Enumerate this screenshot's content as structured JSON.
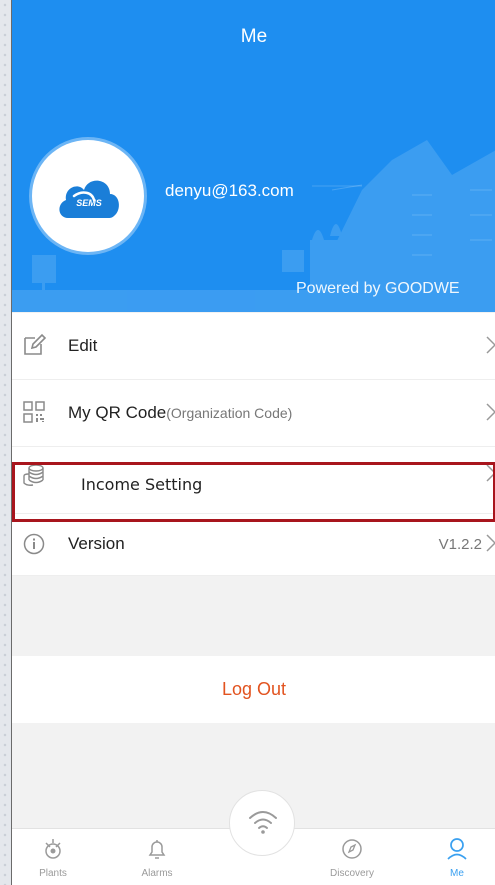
{
  "header": {
    "title": "Me",
    "email": "denyu@163.com",
    "powered_by": "Powered by GOODWE",
    "avatar_logo_text": "SEMS",
    "bg_color": "#1e8ef0"
  },
  "menu": {
    "items": [
      {
        "label": "Edit",
        "icon": "edit-icon"
      },
      {
        "label": "My QR Code",
        "sublabel": "(Organization Code)",
        "icon": "qr-code-icon"
      },
      {
        "label": "Income Setting",
        "icon": "coins-icon"
      },
      {
        "label": "Version",
        "value": "V1.2.2",
        "icon": "info-icon"
      }
    ]
  },
  "logout": {
    "label": "Log Out",
    "color": "#e2531f"
  },
  "tabbar": {
    "tabs": [
      {
        "label": "Plants",
        "icon": "plant-icon"
      },
      {
        "label": "Alarms",
        "icon": "bell-icon"
      },
      {
        "label": "Discovery",
        "icon": "compass-icon"
      },
      {
        "label": "Me",
        "icon": "user-icon",
        "active": true
      }
    ],
    "center_icon": "wifi-icon"
  },
  "highlight_color": "#a8151d"
}
